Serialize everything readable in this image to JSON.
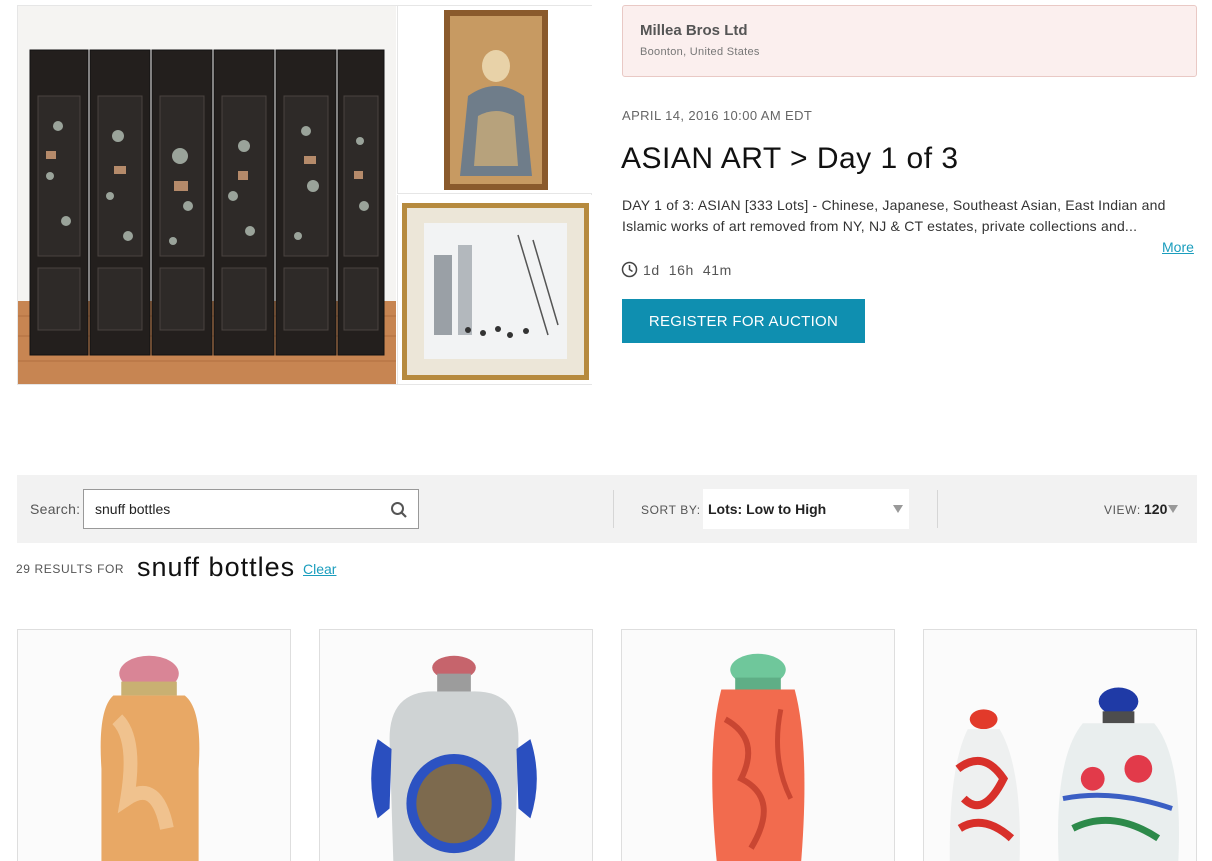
{
  "seller": {
    "name": "Millea Bros Ltd",
    "city": "Boonton,",
    "country": "United States"
  },
  "auction": {
    "date": "APRIL 14, 2016 10:00 AM EDT",
    "title": "ASIAN ART > Day 1 of 3",
    "description": "DAY 1 of 3: ASIAN [333 Lots] - Chinese, Japanese, Southeast Asian, East Indian and Islamic works of art removed from NY, NJ & CT estates, private collections and...",
    "more_label": "More",
    "countdown": "1d  16h  41m",
    "register_label": "REGISTER FOR AUCTION"
  },
  "gallery": {
    "main_alt": "Chinese lacquered six-panel folding screen with hardstone inlay",
    "top_right_alt": "Framed Chinese painting of a seated figure",
    "bottom_right_alt": "Framed winter street scene painting"
  },
  "toolbar": {
    "search_label": "Search:",
    "search_value": "snuff bottles",
    "sort_label": "SORT BY:",
    "sort_value": "Lots: Low to High",
    "view_label": "VIEW:",
    "view_value": "120"
  },
  "results": {
    "count_label": "29 RESULTS FOR",
    "term": "snuff bottles",
    "clear_label": "Clear"
  },
  "lots": [
    {
      "alt": "Agate snuff bottle with pink stopper"
    },
    {
      "alt": "Glass snuff bottle with blue overlay and gilt panel"
    },
    {
      "alt": "Carved coral snuff bottle with green stopper"
    },
    {
      "alt": "Two Peking glass overlay snuff bottles"
    }
  ],
  "colors": {
    "accent": "#0f8fb0",
    "link": "#1a9dbd",
    "seller_bg": "#fbefee"
  }
}
